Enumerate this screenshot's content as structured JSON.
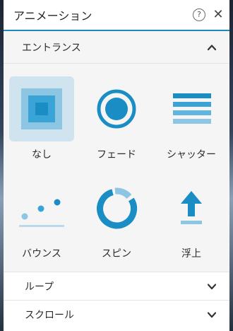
{
  "header": {
    "title": "アニメーション",
    "help_glyph": "?",
    "close_glyph": "✕"
  },
  "entrance": {
    "label": "エントランス",
    "expanded": true,
    "effects": [
      {
        "label": "なし",
        "icon": "none-square-icon",
        "selected": true
      },
      {
        "label": "フェード",
        "icon": "fade-circle-icon",
        "selected": false
      },
      {
        "label": "シャッター",
        "icon": "shutter-lines-icon",
        "selected": false
      },
      {
        "label": "バウンス",
        "icon": "bounce-dots-icon",
        "selected": false
      },
      {
        "label": "スピン",
        "icon": "spin-arc-icon",
        "selected": false
      },
      {
        "label": "浮上",
        "icon": "float-up-arrow-icon",
        "selected": false
      }
    ]
  },
  "loop": {
    "label": "ループ",
    "expanded": false
  },
  "scroll": {
    "label": "スクロール",
    "expanded": false
  },
  "colors": {
    "accent": "#1a8ec4",
    "accent_light": "#8cc6e2",
    "selected_bg": "#cfe4ee"
  }
}
